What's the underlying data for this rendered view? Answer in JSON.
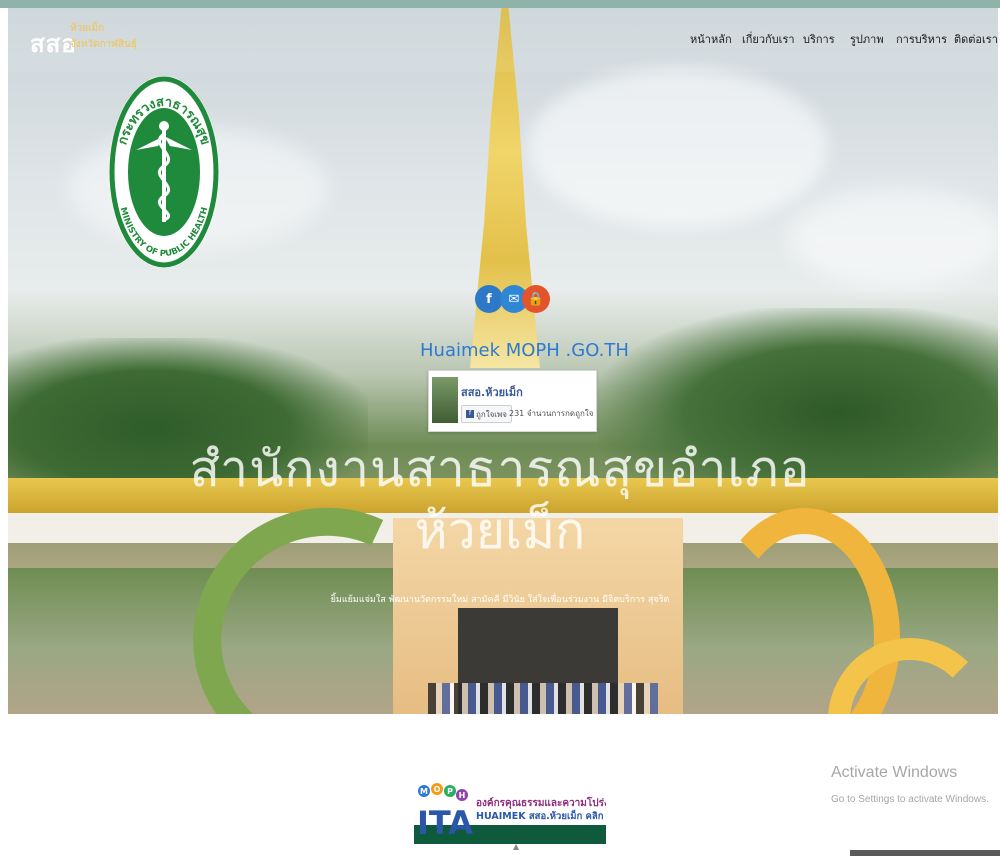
{
  "brand": {
    "logo_text": "สสอ",
    "sub_line1": "ห้วยเม็ก",
    "sub_line2": "จังหวัดกาฬสินธุ์"
  },
  "nav": {
    "items": [
      {
        "label": "หน้าหลัก"
      },
      {
        "label": "เกี่ยวกับเรา"
      },
      {
        "label": "บริการ"
      },
      {
        "label": "รูปภาพ"
      },
      {
        "label": "การบริหาร"
      },
      {
        "label": "ติดต่อเรา"
      }
    ]
  },
  "moph_logo": {
    "top_text": "กระทรวงสาธารณสุข",
    "bottom_text": "MINISTRY OF PUBLIC HEALTH"
  },
  "social": {
    "facebook": "f",
    "email": "✉",
    "lock": "🔒"
  },
  "site_name": "Huaimek MOPH .GO.TH",
  "fb_card": {
    "page_name": "สสอ.ห้วยเม็ก",
    "like_label": "ถูกใจเพจ",
    "like_count": "231 จำนวนการกดถูกใจ"
  },
  "hero": {
    "title_line1": "สำนักงานสาธารณสุขอำเภอ",
    "title_line2": "ห้วยเม็ก",
    "motto": "ยิ้มแย้มแจ่มใส พัฒนานวัตกรรมใหม่ สามัคคี มีวินัย ใส่ใจเพื่อนร่วมงาน มีจิตบริการ สุจริต"
  },
  "ita": {
    "line1": "องค์กรคุณธรรมและความโปร่งใส",
    "line2": "HUAIMEK สสอ.ห้วยเม็ก คลิก",
    "logo_text": "ITA",
    "moph_dots": [
      "M",
      "O",
      "P",
      "H"
    ]
  },
  "windows": {
    "line1": "Activate Windows",
    "line2": "Go to Settings to activate Windows."
  },
  "colors": {
    "accent_blue": "#2e7ad1",
    "facebook": "#3b5998",
    "gold": "#f3c54a",
    "moph_green": "#1f8a3c"
  }
}
